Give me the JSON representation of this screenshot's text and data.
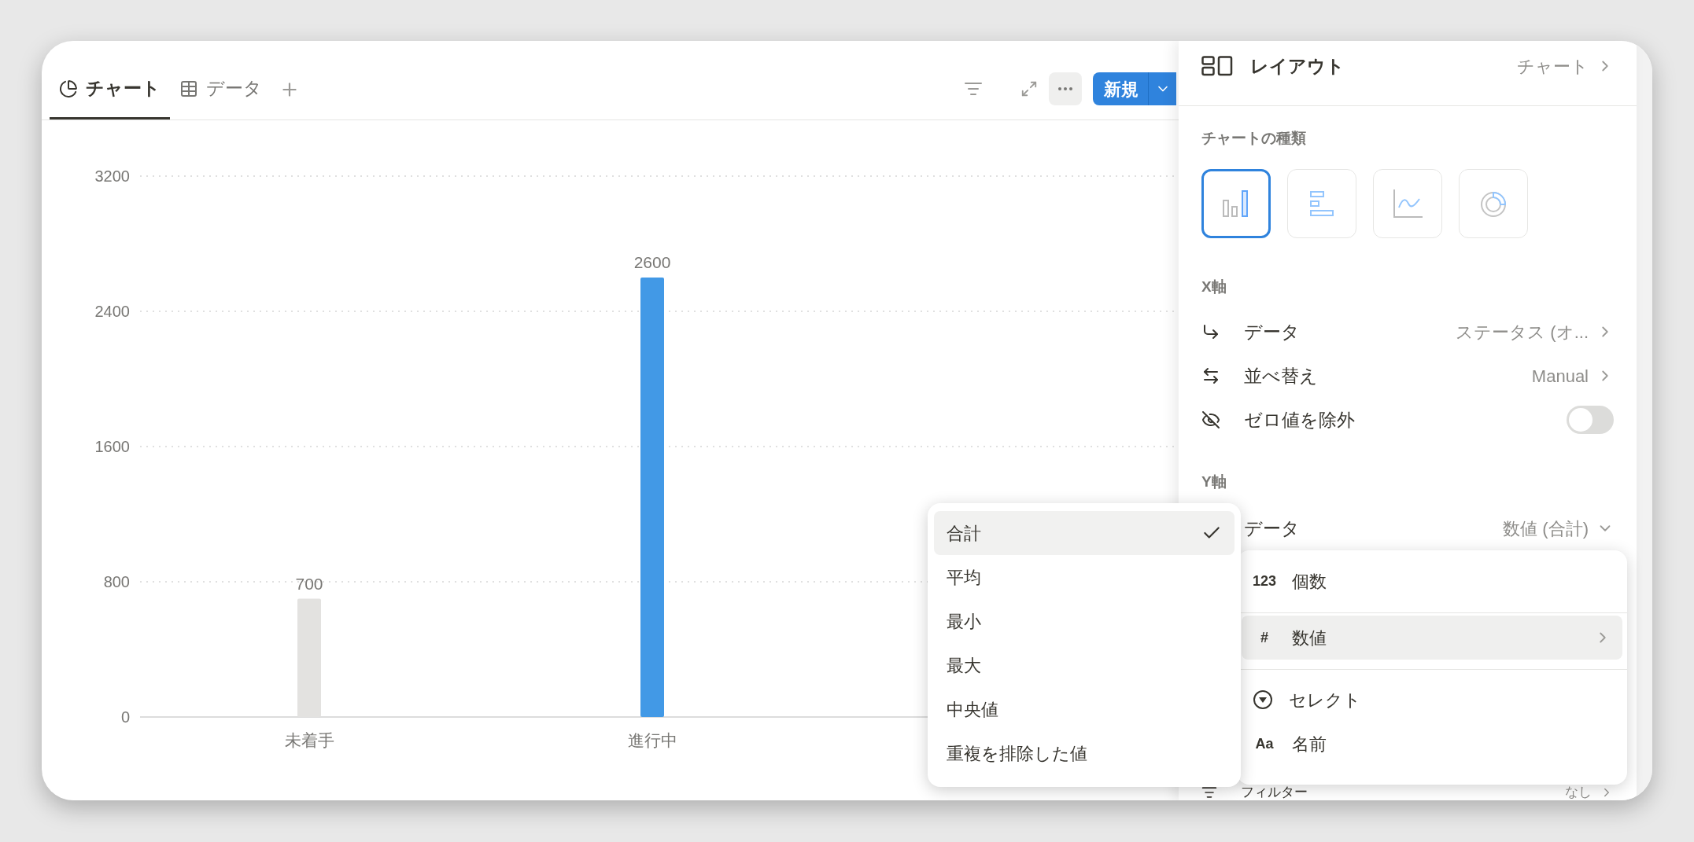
{
  "tabs": [
    {
      "label": "チャート",
      "kind": "chart",
      "selected": true
    },
    {
      "label": "データ",
      "kind": "table",
      "selected": false
    }
  ],
  "toolbar": {
    "new_button": "新規"
  },
  "chart": {
    "bars": [
      {
        "highlighted": false
      },
      {
        "highlighted": true
      }
    ],
    "chart_data": {
      "type": "bar",
      "categories": [
        "未着手",
        "進行中"
      ],
      "values": [
        700,
        2600
      ],
      "ylim": [
        0,
        3200
      ],
      "yticks": [
        0,
        800,
        1600,
        2400,
        3200
      ],
      "grid": true,
      "data_labels": true
    }
  },
  "aggregate_menu": {
    "items": [
      {
        "label": "合計",
        "selected": true
      },
      {
        "label": "平均",
        "selected": false
      },
      {
        "label": "最小",
        "selected": false
      },
      {
        "label": "最大",
        "selected": false
      },
      {
        "label": "中央値",
        "selected": false
      },
      {
        "label": "重複を排除した値",
        "selected": false
      }
    ]
  },
  "property_menu": {
    "items": [
      {
        "kind": "glyph",
        "glyph": "123",
        "label": "個数",
        "selected": false,
        "submenu": false
      },
      {
        "kind": "glyph",
        "glyph": "#",
        "label": "数値",
        "selected": true,
        "submenu": true
      },
      {
        "kind": "select",
        "label": "セレクト",
        "selected": false,
        "submenu": false
      },
      {
        "kind": "glyph",
        "glyph": "Aa",
        "label": "名前",
        "selected": false,
        "submenu": false
      }
    ]
  },
  "panel": {
    "layout": {
      "label": "レイアウト",
      "value": "チャート"
    },
    "chart_types": {
      "title": "チャートの種類",
      "options": [
        {
          "kind": "column",
          "selected": true
        },
        {
          "kind": "bar",
          "selected": false
        },
        {
          "kind": "line",
          "selected": false
        },
        {
          "kind": "donut",
          "selected": false
        }
      ]
    },
    "x_axis": {
      "title": "X軸",
      "rows": [
        {
          "kind": "data",
          "label": "データ",
          "value": "ステータス (オ..."
        },
        {
          "kind": "sort",
          "label": "並べ替え",
          "value": "Manual"
        },
        {
          "kind": "toggle",
          "label": "ゼロ値を除外",
          "on": false
        }
      ]
    },
    "y_axis": {
      "title": "Y軸",
      "data": {
        "label": "データ",
        "value": "数値 (合計)"
      }
    },
    "filter": {
      "label": "フィルター",
      "value": "なし"
    }
  }
}
